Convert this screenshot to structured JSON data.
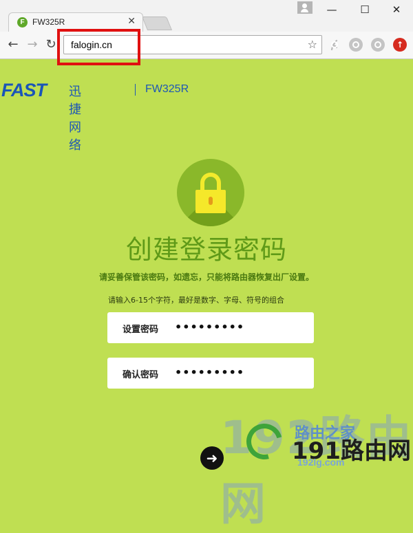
{
  "browser": {
    "tab": {
      "favicon": "F",
      "title": "FW325R",
      "close": "✕"
    },
    "window_controls": {
      "minimize": "—",
      "maximize": "☐",
      "close": "✕"
    },
    "nav": {
      "back": "←",
      "forward": "→",
      "reload": "↻"
    },
    "url": "falogin.cn",
    "star": "☆"
  },
  "header": {
    "brand": "FAST",
    "brand_cn": "迅捷网络",
    "model": "FW325R"
  },
  "main": {
    "title": "创建登录密码",
    "warning": "请妥善保管该密码，如遗忘，只能将路由器恢复出厂设置。",
    "hint": "请输入6-15个字符，最好是数字、字母、符号的组合",
    "fields": [
      {
        "label": "设置密码",
        "value": "•••••••••"
      },
      {
        "label": "确认密码",
        "value": "•••••••••"
      }
    ],
    "next": "➜"
  },
  "watermark": {
    "big": "192路由网",
    "line1": "路由之家",
    "line2": "191路由网",
    "site": "192lg.com"
  },
  "colors": {
    "page_bg": "#bfdf52",
    "brand_blue": "#1a55b8",
    "title_green": "#5f9a18",
    "highlight_red": "#e01010"
  }
}
